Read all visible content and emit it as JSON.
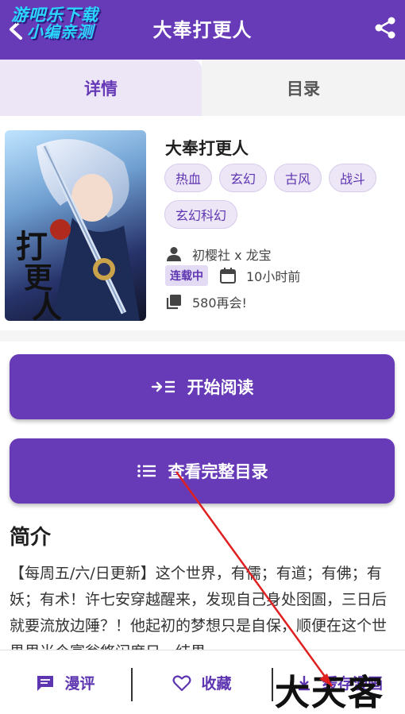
{
  "header": {
    "title": "大奉打更人",
    "watermark_line1": "游吧乐下载",
    "watermark_line2": "小编亲测"
  },
  "tabs": [
    {
      "label": "详情",
      "active": true
    },
    {
      "label": "目录",
      "active": false
    }
  ],
  "book": {
    "title": "大奉打更人",
    "tags": [
      "热血",
      "玄幻",
      "古风",
      "战斗",
      "玄幻科幻"
    ],
    "author": "初樱社 x 龙宝",
    "status": "连载中",
    "updated": "10小时前",
    "latest_chapter": "580再会!"
  },
  "actions": {
    "read_label": "开始阅读",
    "toc_label": "查看完整目录"
  },
  "intro": {
    "heading": "简介",
    "text": "【每周五/六/日更新】这个世界，有儒；有道；有佛；有妖；有术！许七安穿越醒来，发现自己身处囹圄，三日后就要流放边陲？！他起初的梦想只是自保，顺便在这个世界里当个富翁悠闲度日，结果"
  },
  "bottom_bar": {
    "review_label": "漫评",
    "favorite_label": "收藏",
    "cache_label": "缓存漫画",
    "stamp_text": "大天客"
  },
  "colors": {
    "primary": "#673ab7",
    "tag_bg": "#ece6f6",
    "annotation_arrow": "#e02020"
  }
}
